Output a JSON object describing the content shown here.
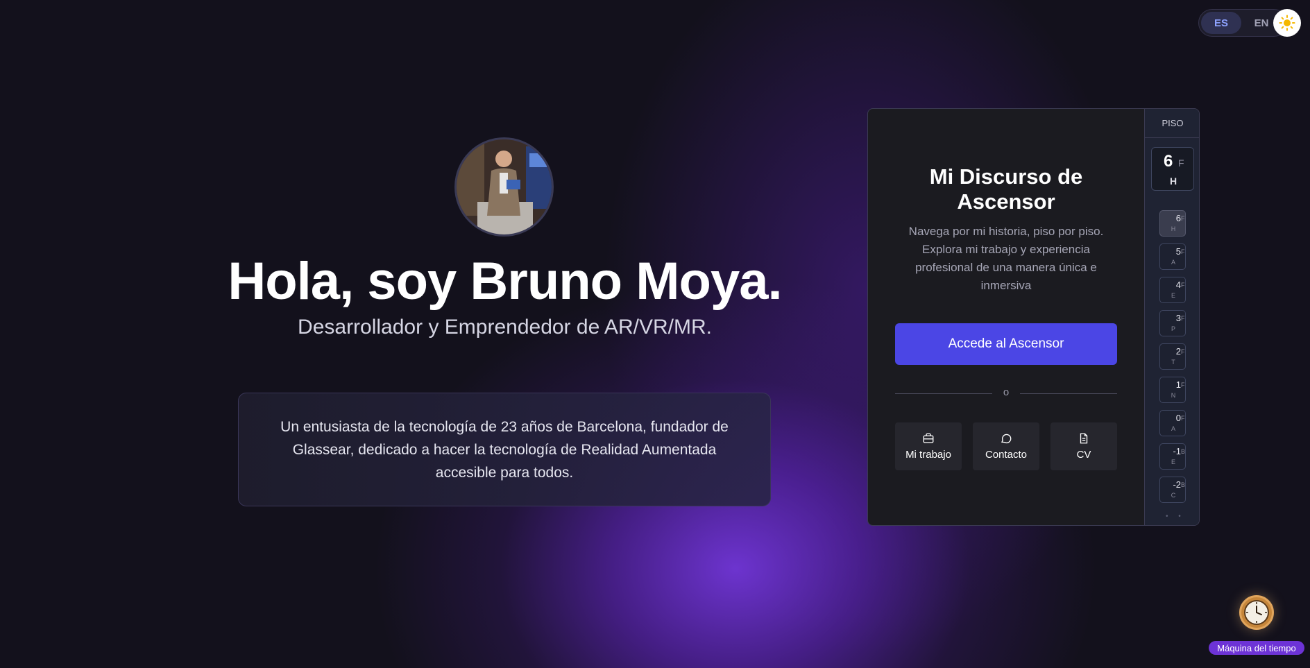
{
  "language": {
    "options": [
      {
        "code": "ES",
        "active": true
      },
      {
        "code": "EN",
        "active": false
      }
    ]
  },
  "theme_toggle": {
    "icon": "sun-icon"
  },
  "hero": {
    "title": "Hola, soy Bruno Moya.",
    "subtitle": "Desarrollador y Emprendedor de AR/VR/MR.",
    "bio": "Un entusiasta de la tecnología de 23 años de Barcelona, fundador de Glassear, dedicado a hacer la tecnología de Realidad Aumentada accesible para todos."
  },
  "elevator": {
    "title": "Mi Discurso de Ascensor",
    "description": "Navega por mi historia, piso por piso. Explora mi trabajo y experiencia profesional de una manera única e inmersiva",
    "cta": "Accede al Ascensor",
    "divider": "o",
    "quick_links": [
      {
        "label": "Mi trabajo",
        "icon": "briefcase-icon"
      },
      {
        "label": "Contacto",
        "icon": "chat-bubble-icon"
      },
      {
        "label": "CV",
        "icon": "document-icon"
      }
    ],
    "floor_label": "PISO",
    "current_floor": {
      "num": "6",
      "type": "F",
      "letter": "H"
    },
    "floors": [
      {
        "num": "6",
        "type": "F",
        "letter": "H",
        "active": true
      },
      {
        "num": "5",
        "type": "F",
        "letter": "A",
        "active": false
      },
      {
        "num": "4",
        "type": "F",
        "letter": "E",
        "active": false
      },
      {
        "num": "3",
        "type": "F",
        "letter": "P",
        "active": false
      },
      {
        "num": "2",
        "type": "F",
        "letter": "T",
        "active": false
      },
      {
        "num": "1",
        "type": "F",
        "letter": "N",
        "active": false
      },
      {
        "num": "0",
        "type": "F",
        "letter": "A",
        "active": false
      },
      {
        "num": "-1",
        "type": "B",
        "letter": "E",
        "active": false
      },
      {
        "num": "-2",
        "type": "B",
        "letter": "C",
        "active": false
      }
    ],
    "more_indicator": "• •"
  },
  "time_machine": {
    "label": "Máquina del tiempo",
    "icon": "clock-icon"
  },
  "colors": {
    "background": "#13111c",
    "accent": "#4b46e5",
    "glow": "#7c3aed",
    "badge": "#6d33d6"
  }
}
